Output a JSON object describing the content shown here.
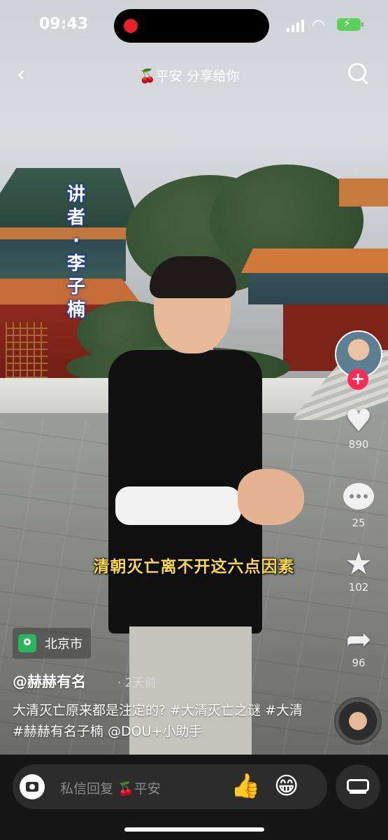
{
  "status_bar": {
    "time": "09:43"
  },
  "top_bar": {
    "share_text": "🍒平安 分享给你"
  },
  "video": {
    "vertical_caption": [
      "讲",
      "者",
      "·",
      "李",
      "子",
      "楠"
    ],
    "subtitle": "清朝灭亡离不开这六点因素"
  },
  "actions": {
    "like_count": "890",
    "comment_count": "25",
    "favorite_count": "102",
    "share_count": "96",
    "follow_symbol": "+"
  },
  "info": {
    "location": "北京市",
    "author": "@赫赫有名",
    "posted": "· 2天前",
    "description": "大清灭亡原来都是注定的? #大清灭亡之谜 #大清 #赫赫有名子楠 @DOU+小助手"
  },
  "bottom_bar": {
    "reply_placeholder": "私信回复 🍒平安",
    "emoji_thumb": "👍",
    "emoji_grin": "😁"
  },
  "colors": {
    "like_red": "#fe2c55",
    "subtitle_yellow": "#f5d94a",
    "location_green": "#2db55d"
  }
}
